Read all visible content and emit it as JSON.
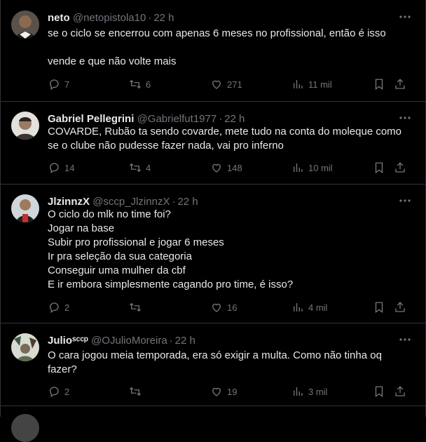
{
  "tweets": [
    {
      "name": "neto",
      "handle": "@netopistola10",
      "time": "22 h",
      "text": "se o ciclo se encerrou com apenas 6 meses no profissional, então é isso\n\nvende e que não volte mais",
      "replies": "7",
      "retweets": "6",
      "likes": "271",
      "views": "11 mil"
    },
    {
      "name": "Gabriel Pellegrini",
      "handle": "@Gabrielfut1977",
      "time": "22 h",
      "text": "COVARDE, Rubão ta sendo covarde, mete tudo na conta do moleque como se o clube não pudesse fazer nada, vai pro inferno",
      "replies": "14",
      "retweets": "4",
      "likes": "148",
      "views": "10 mil"
    },
    {
      "name": "JlzinnzX",
      "handle": "@sccp_JlzinnzX",
      "time": "22 h",
      "text": "O ciclo do mlk no time foi?\nJogar na base\nSubir pro profissional e jogar 6 meses\nIr pra seleção da sua categoria\nConseguir uma mulher da cbf\nE ir embora simplesmente cagando pro time, é isso?",
      "replies": "2",
      "retweets": "",
      "likes": "16",
      "views": "4 mil"
    },
    {
      "name": "Julioˢᶜᶜᵖ",
      "handle": "@OJulioMoreira",
      "time": "22 h",
      "text": "O cara jogou meia temporada, era só exigir a multa. Como não tinha oq fazer?",
      "replies": "2",
      "retweets": "",
      "likes": "19",
      "views": "3 mil"
    }
  ],
  "separator": "·",
  "icons": {
    "more": "more-horizontal-icon",
    "reply": "reply-icon",
    "retweet": "retweet-icon",
    "like": "heart-icon",
    "views": "views-bar-chart-icon",
    "bookmark": "bookmark-icon",
    "share": "share-icon"
  },
  "colors": {
    "background": "#000000",
    "text": "#e7e9ea",
    "muted": "#71767b",
    "divider": "#2f3336"
  }
}
